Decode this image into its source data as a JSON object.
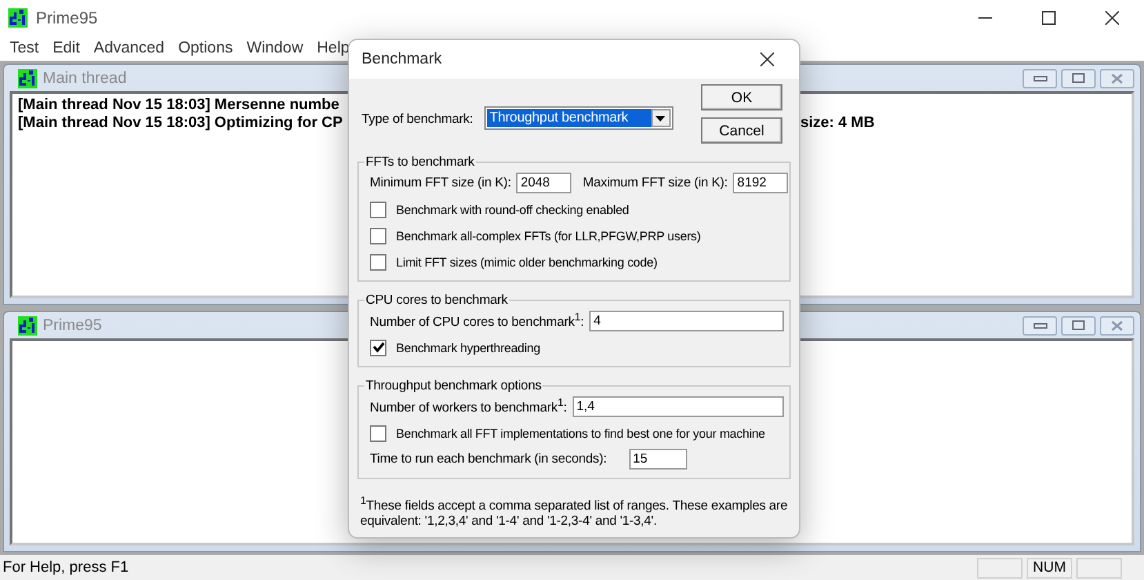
{
  "window": {
    "title": "Prime95"
  },
  "menu": [
    "Test",
    "Edit",
    "Advanced",
    "Options",
    "Window",
    "Help"
  ],
  "mdi_windows": [
    {
      "title": "Main thread",
      "lines": [
        {
          "text": "[Main thread Nov 15 18:03] Mersenne numbe"
        },
        {
          "text": "[Main thread Nov 15 18:03] Optimizing for CP",
          "tail": "size: 4 MB"
        }
      ]
    },
    {
      "title": "Prime95"
    }
  ],
  "dialog": {
    "title": "Benchmark",
    "type_label": "Type of benchmark:",
    "type_value": "Throughput benchmark",
    "buttons": [
      "OK",
      "Cancel"
    ],
    "groups": [
      {
        "title": "FFTs to benchmark",
        "rows": [
          {
            "kind": "range",
            "min_label": "Minimum FFT size (in K):",
            "min_value": "2048",
            "max_label": "Maximum FFT size (in K):",
            "max_value": "8192"
          },
          {
            "kind": "checkbox",
            "label": "Benchmark with round-off checking enabled",
            "checked": false
          },
          {
            "kind": "checkbox",
            "label": "Benchmark all-complex FFTs (for LLR,PFGW,PRP users)",
            "checked": false
          },
          {
            "kind": "checkbox",
            "label": "Limit FFT sizes (mimic older benchmarking code)",
            "checked": false
          }
        ]
      },
      {
        "title": "CPU cores to benchmark",
        "rows": [
          {
            "kind": "field",
            "label": "Number of CPU cores to benchmark$^{1}$:",
            "value": "4"
          },
          {
            "kind": "checkbox",
            "label": "Benchmark hyperthreading",
            "checked": true
          }
        ]
      },
      {
        "title": "Throughput benchmark options",
        "rows": [
          {
            "kind": "field",
            "label": "Number of workers to benchmark$^{1}$:",
            "value": "1,4"
          },
          {
            "kind": "checkbox",
            "label": "Benchmark all FFT implementations to find best one for your machine",
            "checked": false
          },
          {
            "kind": "short-field",
            "label": "Time to run each benchmark (in seconds):",
            "value": "15"
          }
        ]
      }
    ],
    "footnote": "$^{1}$These fields accept a comma separated list of ranges.  These examples are equivalent: '1,2,3,4' and '1-4' and '1-2,3-4' and '1-3,4'."
  },
  "status_bar": {
    "text": "For Help, press F1",
    "panes": [
      {
        "kind": "empty"
      },
      {
        "kind": "text",
        "label": "NUM"
      },
      {
        "kind": "empty"
      }
    ]
  }
}
